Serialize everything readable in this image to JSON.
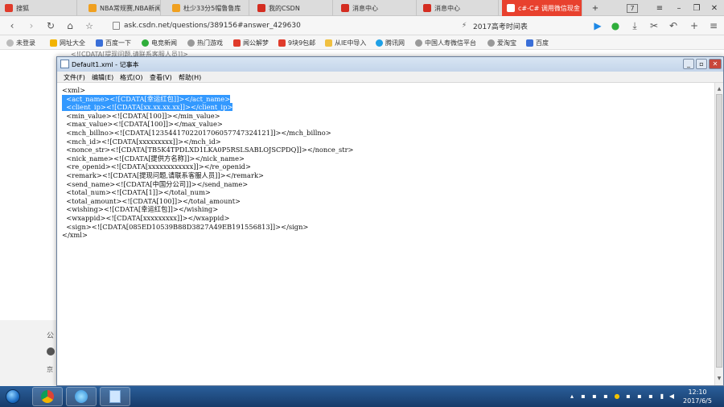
{
  "browser": {
    "tabs": [
      {
        "label": "搜狐",
        "color": "#e03b2b"
      },
      {
        "label": "NBA常规赛,NBA新闻",
        "color": "#f0a020"
      },
      {
        "label": "杜少33分5帽鲁鲁库",
        "color": "#f0a020"
      },
      {
        "label": "我的CSDN",
        "color": "#d42d21"
      },
      {
        "label": "消息中心",
        "color": "#d42d21"
      },
      {
        "label": "消息中心",
        "color": "#d42d21"
      },
      {
        "label": "c#-C# 调用微信现金",
        "color": "#ffffff"
      }
    ],
    "tab_count": "7",
    "url": "ask.csdn.net/questions/389156#answer_429630",
    "search_text": "2017高考时间表"
  },
  "bookmarks": {
    "items": [
      {
        "label": "未登录"
      },
      {
        "label": "网址大全"
      },
      {
        "label": "百度一下"
      },
      {
        "label": "电竞新闻"
      },
      {
        "label": "热门游戏"
      },
      {
        "label": "闻公解梦"
      },
      {
        "label": "9块9包邮"
      },
      {
        "label": "从IE中导入"
      },
      {
        "label": "腾讯网"
      },
      {
        "label": "中国人寿微信平台"
      },
      {
        "label": "爱淘宝"
      },
      {
        "label": "百度"
      }
    ]
  },
  "page": {
    "snippet": "<![CDATA[提现问题,请联系客服人员]]>",
    "side_labels": [
      "公",
      "京"
    ]
  },
  "notepad": {
    "title": "Default1.xml - 记事本",
    "menu": [
      "文件(F)",
      "编辑(E)",
      "格式(O)",
      "查看(V)",
      "帮助(H)"
    ],
    "lines": [
      "<xml>",
      "  <act_name><![CDATA[幸运红包]]></act_name>",
      "  <client_ip><![CDATA[xx.xx.xx.xx]]></client_ip>",
      "  <min_value><![CDATA[100]]></min_value>",
      "  <max_value><![CDATA[100]]></max_value>",
      "  <mch_billno><![CDATA[12354417022017060577473241​21]]></mch_billno>",
      "  <mch_id><![CDATA[xxxxxxxxx]]></mch_id>",
      "  <nonce_str><![CDATA[TB5K4TPDLXD1LKA0P5RSLSABLOJSCPDQ]]></nonce_str>",
      "  <nick_name><![CDATA[提供方名称]]></nick_name>",
      "  <re_openid><![CDATA[xxxxxxxxxxxx]]></re_openid>",
      "  <remark><![CDATA[提现问题,请联系客服人员]]></remark>",
      "  <send_name><![CDATA[中国分公司]]></send_name>",
      "  <total_num><![CDATA[1]]></total_num>",
      "  <total_amount><![CDATA[100]]></total_amount>",
      "  <wishing><![CDATA[幸运红包]]></wishing>",
      "  <wxappid><![CDATA[xxxxxxxxx]]></wxappid>",
      "  <sign><![CDATA[085ED10539B88D3827A49EB191556813]]></sign>",
      "</xml>"
    ]
  },
  "taskbar": {
    "time": "12:10",
    "date": "2017/6/5"
  }
}
